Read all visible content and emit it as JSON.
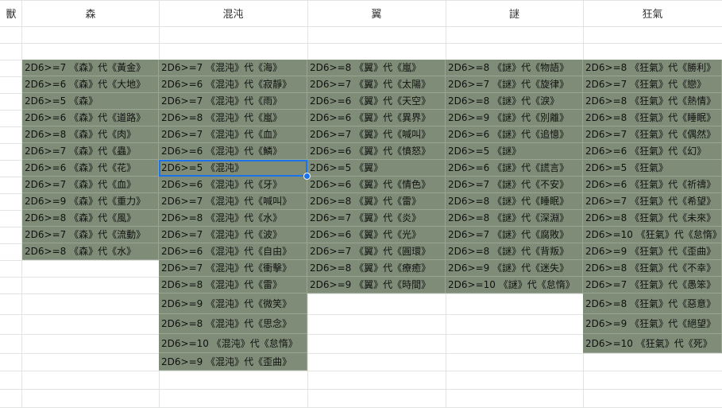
{
  "sheet": {
    "row_header_label": "獸",
    "columns": [
      {
        "header": "森",
        "cells": [
          "2D6>=7 《森》代《黃金》",
          "2D6>=6 《森》代《大地》",
          "2D6>=5 《森》",
          "2D6>=6 《森》代《道路》",
          "2D6>=8 《森》代《肉》",
          "2D6>=7 《森》代《蟲》",
          "2D6>=6 《森》代《花》",
          "2D6>=7 《森》代《血》",
          "2D6>=9 《森》代《重力》",
          "2D6>=8 《森》代《風》",
          "2D6>=7 《森》代《流動》",
          "2D6>=8 《森》代《水》"
        ]
      },
      {
        "header": "混沌",
        "cells": [
          "2D6>=7 《混沌》代《海》",
          "2D6>=6 《混沌》代《寂靜》",
          "2D6>=7 《混沌》代《雨》",
          "2D6>=8 《混沌》代《嵐》",
          "2D6>=7 《混沌》代《血》",
          "2D6>=6 《混沌》代《鱗》",
          "2D6>=5 《混沌》",
          "2D6>=6 《混沌》代《牙》",
          "2D6>=7 《混沌》代《喊叫》",
          "2D6>=8 《混沌》代《水》",
          "2D6>=7 《混沌》代《波》",
          "2D6>=6 《混沌》代《自由》",
          "2D6>=7 《混沌》代《衝擊》",
          "2D6>=8 《混沌》代《雷》",
          "2D6>=9 《混沌》代《微笑》",
          "2D6>=8 《混沌》代《思念》",
          "2D6>=10 《混沌》代《怠惰》",
          "2D6>=9 《混沌》代《歪曲》"
        ]
      },
      {
        "header": "翼",
        "cells": [
          "2D6>=8 《翼》代《嵐》",
          "2D6>=7 《翼》代《太陽》",
          "2D6>=6 《翼》代《天空》",
          "2D6>=6 《翼》代《異界》",
          "2D6>=7 《翼》代《喊叫》",
          "2D6>=6 《翼》代《憤怒》",
          "2D6>=5 《翼》",
          "2D6>=6 《翼》代《情色》",
          "2D6>=8 《翼》代《雷》",
          "2D6>=7 《翼》代《炎》",
          "2D6>=6 《翼》代《光》",
          "2D6>=7 《翼》代《圓環》",
          "2D6>=8 《翼》代《療癒》",
          "2D6>=9 《翼》代《時間》"
        ]
      },
      {
        "header": "謎",
        "cells": [
          "2D6>=8 《謎》代《物語》",
          "2D6>=7 《謎》代《旋律》",
          "2D6>=8 《謎》代《淚》",
          "2D6>=9 《謎》代《別離》",
          "2D6>=6 《謎》代《追憶》",
          "2D6>=5 《謎》",
          "2D6>=6 《謎》代《謊言》",
          "2D6>=7 《謎》代《不安》",
          "2D6>=8 《謎》代《睡眠》",
          "2D6>=8 《謎》代《深淵》",
          "2D6>=7 《謎》代《腐敗》",
          "2D6>=8 《謎》代《背叛》",
          "2D6>=9 《謎》代《迷失》",
          "2D6>=10 《謎》代《怠惰》"
        ]
      },
      {
        "header": "狂氣",
        "cells": [
          "2D6>=8 《狂氣》代《勝利》",
          "2D6>=7 《狂氣》代《戀》",
          "2D6>=8 《狂氣》代《熱情》",
          "2D6>=8 《狂氣》代《睡眠》",
          "2D6>=7 《狂氣》代《偶然》",
          "2D6>=6 《狂氣》代《幻》",
          "2D6>=5 《狂氣》",
          "2D6>=6 《狂氣》代《祈禱》",
          "2D6>=7 《狂氣》代《希望》",
          "2D6>=8 《狂氣》代《未來》",
          "2D6>=10 《狂氣》代《怠惰》",
          "2D6>=9 《狂氣》代《歪曲》",
          "2D6>=8 《狂氣》代《不幸》",
          "2D6>=7 《狂氣》代《愚笨》",
          "2D6>=8 《狂氣》代《惡意》",
          "2D6>=9 《狂氣》代《絕望》",
          "2D6>=10 《狂氣》代《死》"
        ]
      }
    ],
    "selected_cell_text": "2D6>=5 《混沌》",
    "fill_color": "#7f8d78",
    "selection_color": "#1a73e8"
  }
}
